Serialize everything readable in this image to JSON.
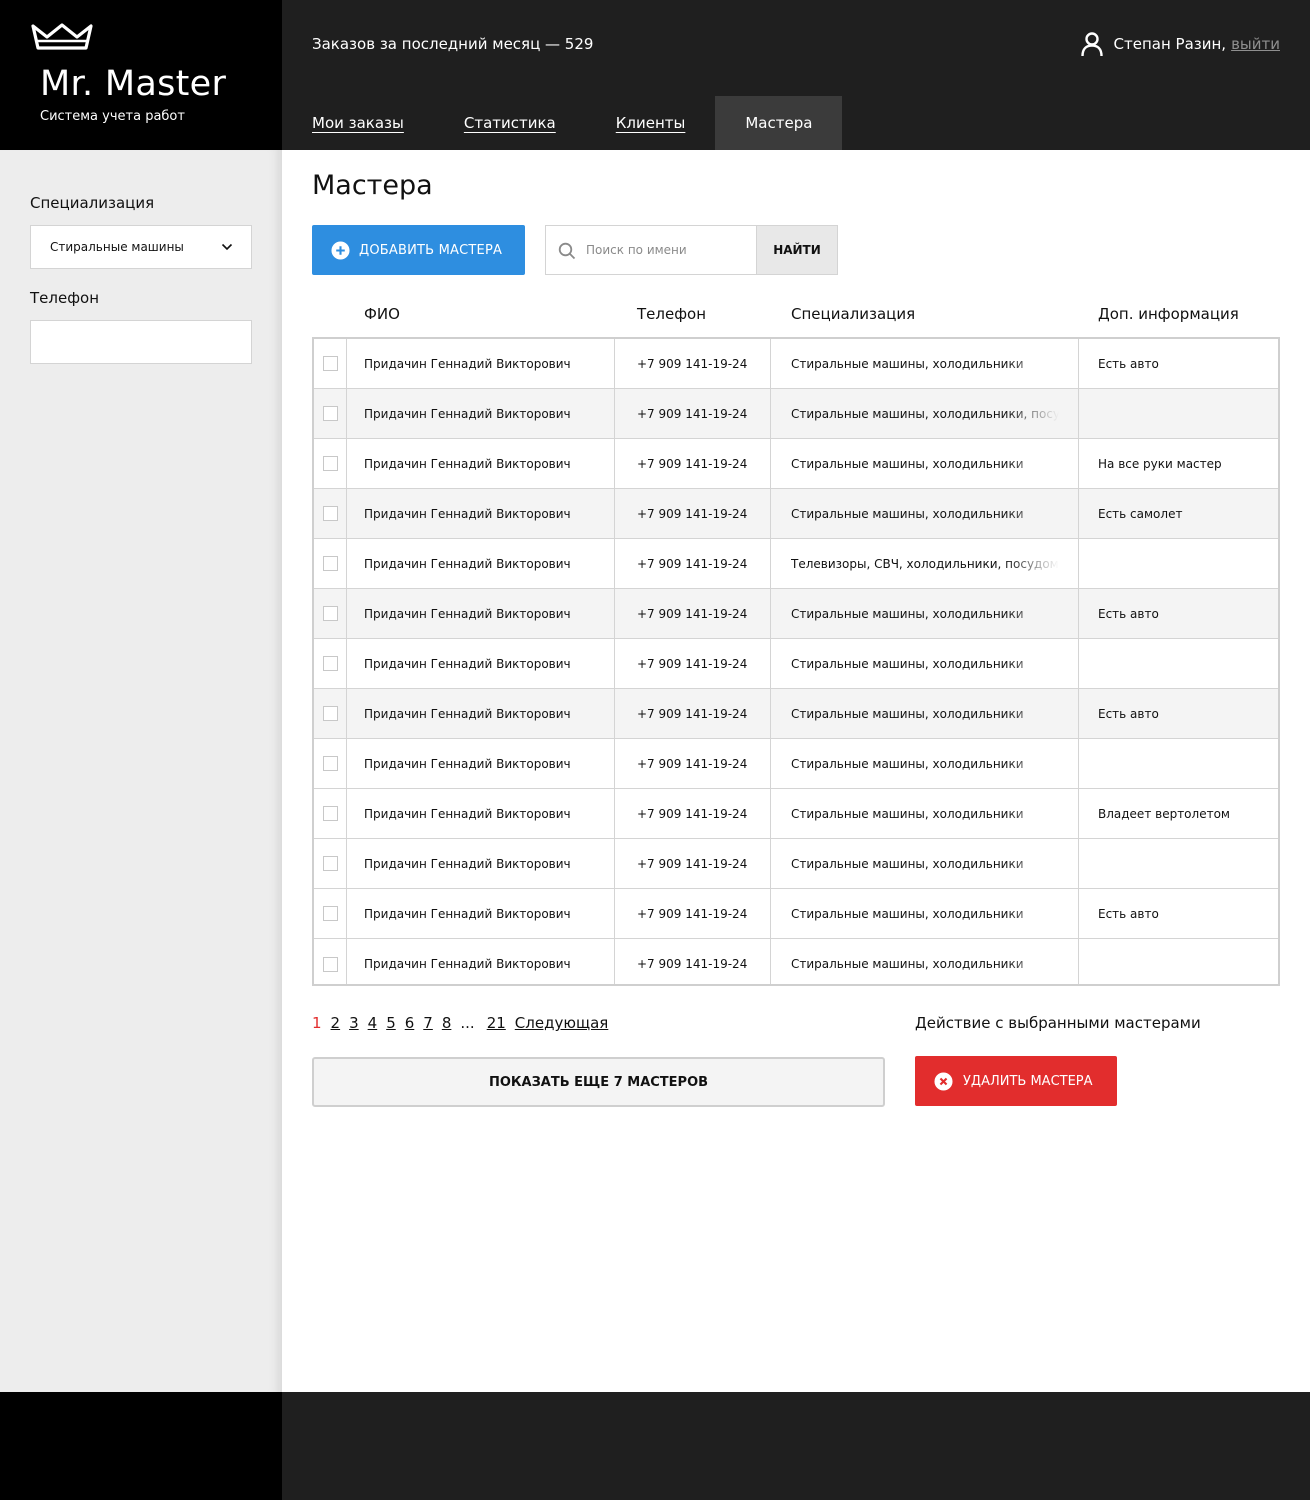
{
  "brand": {
    "title": "Mr. Master",
    "subtitle": "Система учета работ"
  },
  "header": {
    "orders_count": "Заказов за последний месяц — 529",
    "user_name": "Степан Разин,",
    "logout_label": "выйти"
  },
  "nav": {
    "items": [
      {
        "label": "Мои заказы",
        "active": false
      },
      {
        "label": "Статистика",
        "active": false
      },
      {
        "label": "Клиенты",
        "active": false
      },
      {
        "label": "Мастера",
        "active": true
      }
    ]
  },
  "sidebar": {
    "specialization_label": "Специализация",
    "specialization_value": "Стиральные машины",
    "phone_label": "Телефон",
    "phone_value": ""
  },
  "main": {
    "title": "Мастера",
    "add_button_label": "ДОБАВИТЬ МАСТЕРА",
    "search_placeholder": "Поиск по имени",
    "search_value": "",
    "find_button_label": "НАЙТИ"
  },
  "table": {
    "columns": [
      "ФИО",
      "Телефон",
      "Специализация",
      "Доп. информация"
    ],
    "rows": [
      {
        "name": "Придачин Геннадий Викторович",
        "phone": "+7 909 141-19-24",
        "spec": "Стиральные машины, холодильники",
        "info": "Есть авто"
      },
      {
        "name": "Придачин Геннадий Викторович",
        "phone": "+7 909 141-19-24",
        "spec": "Стиральные машины, холодильники, посудомоечные машины",
        "info": ""
      },
      {
        "name": "Придачин Геннадий Викторович",
        "phone": "+7 909 141-19-24",
        "spec": "Стиральные машины, холодильники",
        "info": "На все руки мастер"
      },
      {
        "name": "Придачин Геннадий Викторович",
        "phone": "+7 909 141-19-24",
        "spec": "Стиральные машины, холодильники",
        "info": "Есть самолет"
      },
      {
        "name": "Придачин Геннадий Викторович",
        "phone": "+7 909 141-19-24",
        "spec": "Телевизоры, СВЧ, холодильники, посудомоечные машины",
        "info": ""
      },
      {
        "name": "Придачин Геннадий Викторович",
        "phone": "+7 909 141-19-24",
        "spec": "Стиральные машины, холодильники",
        "info": "Есть авто"
      },
      {
        "name": "Придачин Геннадий Викторович",
        "phone": "+7 909 141-19-24",
        "spec": "Стиральные машины, холодильники",
        "info": ""
      },
      {
        "name": "Придачин Геннадий Викторович",
        "phone": "+7 909 141-19-24",
        "spec": "Стиральные машины, холодильники",
        "info": "Есть авто"
      },
      {
        "name": "Придачин Геннадий Викторович",
        "phone": "+7 909 141-19-24",
        "spec": "Стиральные машины, холодильники",
        "info": ""
      },
      {
        "name": "Придачин Геннадий Викторович",
        "phone": "+7 909 141-19-24",
        "spec": "Стиральные машины, холодильники",
        "info": "Владеет вертолетом"
      },
      {
        "name": "Придачин Геннадий Викторович",
        "phone": "+7 909 141-19-24",
        "spec": "Стиральные машины, холодильники",
        "info": ""
      },
      {
        "name": "Придачин Геннадий Викторович",
        "phone": "+7 909 141-19-24",
        "spec": "Стиральные машины, холодильники",
        "info": "Есть авто"
      },
      {
        "name": "Придачин Геннадий Викторович",
        "phone": "+7 909 141-19-24",
        "spec": "Стиральные машины, холодильники",
        "info": ""
      }
    ]
  },
  "pagination": {
    "pages": [
      "1",
      "2",
      "3",
      "4",
      "5",
      "6",
      "7",
      "8"
    ],
    "current": "1",
    "ellipsis": "...",
    "last_page": "21",
    "next_label": "Следующая"
  },
  "actions": {
    "show_more_label": "ПОКАЗАТЬ ЕЩЕ 7 МАСТЕРОВ",
    "selected_label": "Действие с выбранными мастерами",
    "delete_label": "УДАЛИТЬ МАСТЕРА"
  },
  "colors": {
    "primary": "#2e8ee0",
    "danger": "#e22d2d",
    "header_dark": "#1f1f1f",
    "nav_active": "#3b3b3b",
    "sidebar_bg": "#ededed"
  },
  "icons": {
    "logo": "crown-icon",
    "user": "user-icon",
    "add": "plus-circle-icon",
    "search": "search-icon",
    "select": "chevron-down-icon",
    "delete": "close-circle-icon"
  }
}
